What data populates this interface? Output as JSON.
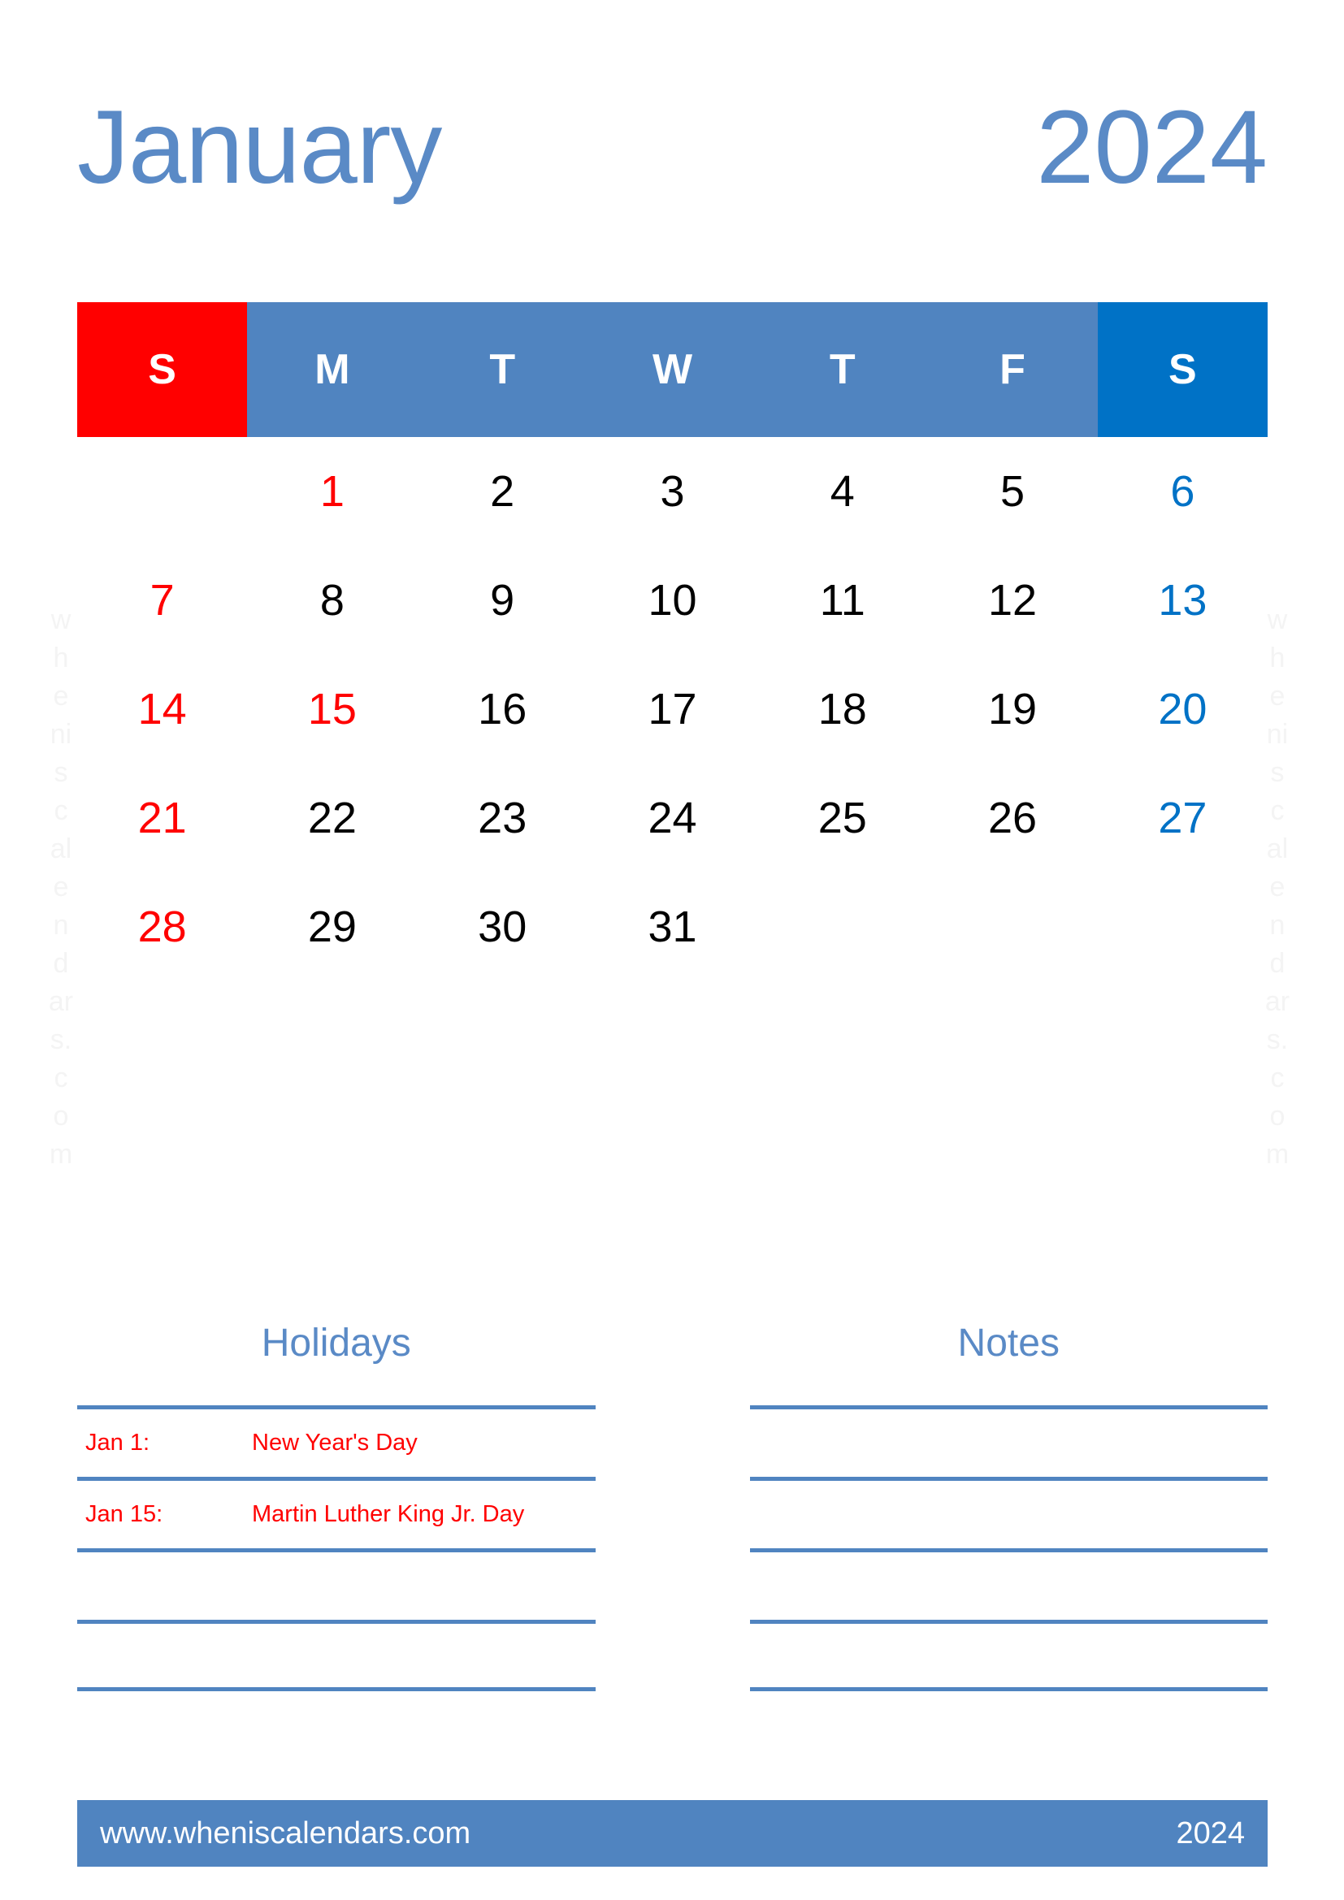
{
  "header": {
    "month": "January",
    "year": "2024"
  },
  "watermark": {
    "text_left": "w\nh\ne\nni\ns\nc\nal\ne\nn\nd\nar\ns.\nc\no\nm",
    "text_right": "w\nh\ne\nni\ns\nc\nal\ne\nn\nd\nar\ns.\nc\no\nm"
  },
  "weekdays": [
    {
      "label": "S",
      "kind": "sun"
    },
    {
      "label": "M",
      "kind": "mid"
    },
    {
      "label": "T",
      "kind": "mid"
    },
    {
      "label": "W",
      "kind": "mid"
    },
    {
      "label": "T",
      "kind": "mid"
    },
    {
      "label": "F",
      "kind": "mid"
    },
    {
      "label": "S",
      "kind": "sat"
    }
  ],
  "weeks": [
    [
      {
        "day": "",
        "style": "empty"
      },
      {
        "day": "1",
        "style": "red"
      },
      {
        "day": "2",
        "style": "black"
      },
      {
        "day": "3",
        "style": "black"
      },
      {
        "day": "4",
        "style": "black"
      },
      {
        "day": "5",
        "style": "black"
      },
      {
        "day": "6",
        "style": "blue"
      }
    ],
    [
      {
        "day": "7",
        "style": "red"
      },
      {
        "day": "8",
        "style": "black"
      },
      {
        "day": "9",
        "style": "black"
      },
      {
        "day": "10",
        "style": "black"
      },
      {
        "day": "11",
        "style": "black"
      },
      {
        "day": "12",
        "style": "black"
      },
      {
        "day": "13",
        "style": "blue"
      }
    ],
    [
      {
        "day": "14",
        "style": "red"
      },
      {
        "day": "15",
        "style": "red"
      },
      {
        "day": "16",
        "style": "black"
      },
      {
        "day": "17",
        "style": "black"
      },
      {
        "day": "18",
        "style": "black"
      },
      {
        "day": "19",
        "style": "black"
      },
      {
        "day": "20",
        "style": "blue"
      }
    ],
    [
      {
        "day": "21",
        "style": "red"
      },
      {
        "day": "22",
        "style": "black"
      },
      {
        "day": "23",
        "style": "black"
      },
      {
        "day": "24",
        "style": "black"
      },
      {
        "day": "25",
        "style": "black"
      },
      {
        "day": "26",
        "style": "black"
      },
      {
        "day": "27",
        "style": "blue"
      }
    ],
    [
      {
        "day": "28",
        "style": "red"
      },
      {
        "day": "29",
        "style": "black"
      },
      {
        "day": "30",
        "style": "black"
      },
      {
        "day": "31",
        "style": "black"
      },
      {
        "day": "",
        "style": "empty"
      },
      {
        "day": "",
        "style": "empty"
      },
      {
        "day": "",
        "style": "empty"
      }
    ]
  ],
  "holidays": {
    "title": "Holidays",
    "rows": [
      {
        "date": "Jan 1:",
        "name": "New Year's Day"
      },
      {
        "date": "Jan 15:",
        "name": "Martin Luther King Jr. Day"
      },
      {
        "date": "",
        "name": ""
      },
      {
        "date": "",
        "name": ""
      }
    ]
  },
  "notes": {
    "title": "Notes",
    "rows": [
      {
        "text": ""
      },
      {
        "text": ""
      },
      {
        "text": ""
      },
      {
        "text": ""
      }
    ]
  },
  "footer": {
    "url": "www.wheniscalendars.com",
    "year": "2024"
  },
  "colors": {
    "brand_blue": "#5084C0",
    "title_blue": "#5A8AC6",
    "saturday_blue": "#0072C6",
    "sunday_red": "#FF0000",
    "watermark_gray": "#F4F4F4"
  }
}
